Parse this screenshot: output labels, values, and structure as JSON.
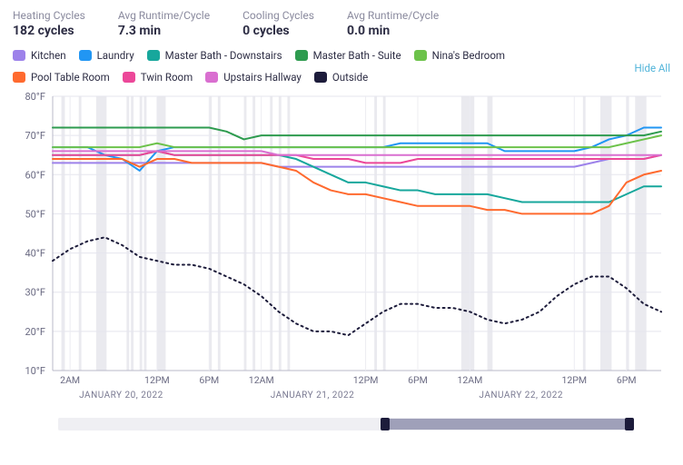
{
  "stats": {
    "heating_cycles_label": "Heating Cycles",
    "heating_cycles_value": "182 cycles",
    "avg_heat_runtime_label": "Avg Runtime/Cycle",
    "avg_heat_runtime_value": "7.3 min",
    "cooling_cycles_label": "Cooling Cycles",
    "cooling_cycles_value": "0 cycles",
    "avg_cool_runtime_label": "Avg Runtime/Cycle",
    "avg_cool_runtime_value": "0.0 min"
  },
  "legend": [
    {
      "name": "Kitchen",
      "color": "#9d82ea"
    },
    {
      "name": "Laundry",
      "color": "#2196f3"
    },
    {
      "name": "Master Bath - Downstairs",
      "color": "#17a79c"
    },
    {
      "name": "Master Bath - Suite",
      "color": "#2e9b4f"
    },
    {
      "name": "Nina's Bedroom",
      "color": "#6cc24a"
    },
    {
      "name": "Pool Table Room",
      "color": "#ff6a2f"
    },
    {
      "name": "Twin Room",
      "color": "#ec4899"
    },
    {
      "name": "Upstairs Hallway",
      "color": "#d96fd0"
    },
    {
      "name": "Outside",
      "color": "#1d1c3b"
    }
  ],
  "hide_all": "Hide All",
  "chart_data": {
    "type": "line",
    "title": "",
    "xlabel": "",
    "ylabel": "°F",
    "ylim": [
      10,
      80
    ],
    "y_ticks": [
      10,
      20,
      30,
      40,
      50,
      60,
      70,
      80
    ],
    "y_tick_suffix": "°F",
    "x_ticks_top": [
      "2AM",
      "12PM",
      "6PM",
      "12AM",
      "12PM",
      "6PM",
      "12AM",
      "12PM",
      "6PM"
    ],
    "x_dates": [
      "JANUARY 20, 2022",
      "JANUARY 21, 2022",
      "JANUARY 22, 2022"
    ],
    "x": [
      0,
      2,
      4,
      6,
      8,
      10,
      12,
      14,
      16,
      18,
      20,
      22,
      24,
      26,
      28,
      30,
      32,
      34,
      36,
      38,
      40,
      42,
      44,
      46,
      48,
      50,
      52,
      54,
      56,
      58,
      60,
      62,
      64,
      66,
      68,
      70
    ],
    "series": [
      {
        "name": "Kitchen",
        "color": "#9d82ea",
        "values": [
          63,
          63,
          63,
          63,
          63,
          63,
          63,
          63,
          63,
          63,
          63,
          63,
          63,
          62,
          62,
          62,
          62,
          62,
          62,
          62,
          62,
          62,
          62,
          62,
          62,
          62,
          62,
          62,
          62,
          62,
          62,
          63,
          64,
          64,
          64,
          65
        ]
      },
      {
        "name": "Laundry",
        "color": "#2196f3",
        "values": [
          67,
          67,
          67,
          65,
          64,
          61,
          66,
          67,
          67,
          67,
          67,
          67,
          67,
          67,
          67,
          67,
          67,
          67,
          67,
          67,
          68,
          68,
          68,
          68,
          68,
          68,
          66,
          66,
          66,
          66,
          66,
          67,
          69,
          70,
          72,
          72
        ]
      },
      {
        "name": "Master Bath - Downstairs",
        "color": "#17a79c",
        "values": [
          65,
          65,
          65,
          65,
          65,
          65,
          66,
          65,
          65,
          65,
          65,
          65,
          65,
          65,
          64,
          62,
          60,
          58,
          58,
          57,
          56,
          56,
          55,
          55,
          55,
          55,
          54,
          53,
          53,
          53,
          53,
          53,
          53,
          55,
          57,
          57
        ]
      },
      {
        "name": "Master Bath - Suite",
        "color": "#2e9b4f",
        "values": [
          72,
          72,
          72,
          72,
          72,
          72,
          72,
          72,
          72,
          72,
          71,
          69,
          70,
          70,
          70,
          70,
          70,
          70,
          70,
          70,
          70,
          70,
          70,
          70,
          70,
          70,
          70,
          70,
          70,
          70,
          70,
          70,
          70,
          70,
          70,
          71
        ]
      },
      {
        "name": "Nina's Bedroom",
        "color": "#6cc24a",
        "values": [
          67,
          67,
          67,
          67,
          67,
          67,
          68,
          67,
          67,
          67,
          67,
          67,
          67,
          67,
          67,
          67,
          67,
          67,
          67,
          67,
          67,
          67,
          67,
          67,
          67,
          67,
          67,
          67,
          67,
          67,
          67,
          67,
          67,
          68,
          69,
          70
        ]
      },
      {
        "name": "Pool Table Room",
        "color": "#ff6a2f",
        "values": [
          64,
          64,
          64,
          64,
          64,
          62,
          64,
          64,
          63,
          63,
          63,
          63,
          63,
          62,
          61,
          58,
          56,
          55,
          55,
          54,
          53,
          52,
          52,
          52,
          52,
          51,
          51,
          50,
          50,
          50,
          50,
          50,
          52,
          58,
          60,
          61
        ]
      },
      {
        "name": "Twin Room",
        "color": "#ec4899",
        "values": [
          65,
          65,
          65,
          65,
          65,
          65,
          66,
          65,
          65,
          65,
          65,
          65,
          65,
          65,
          65,
          64,
          64,
          64,
          63,
          63,
          63,
          64,
          64,
          64,
          64,
          64,
          64,
          64,
          64,
          64,
          64,
          64,
          64,
          64,
          64,
          65
        ]
      },
      {
        "name": "Upstairs Hallway",
        "color": "#d96fd0",
        "values": [
          66,
          66,
          66,
          66,
          66,
          66,
          66,
          66,
          66,
          66,
          66,
          66,
          66,
          65,
          65,
          65,
          65,
          65,
          65,
          65,
          65,
          65,
          65,
          65,
          65,
          65,
          65,
          65,
          65,
          65,
          65,
          65,
          65,
          65,
          65,
          65
        ]
      },
      {
        "name": "Outside",
        "color": "#1d1c3b",
        "dotted": true,
        "values": [
          38,
          41,
          43,
          44,
          42,
          39,
          38,
          37,
          37,
          36,
          34,
          32,
          29,
          25,
          22,
          20,
          20,
          19,
          22,
          25,
          27,
          27,
          26,
          26,
          25,
          23,
          22,
          23,
          25,
          29,
          32,
          34,
          34,
          31,
          27,
          25
        ]
      }
    ],
    "heating_bands_x": [
      1,
      3,
      5,
      8.5,
      9,
      10,
      10.5,
      12,
      18,
      19,
      22,
      23,
      25,
      26,
      27,
      37,
      38,
      47,
      50,
      61,
      63,
      66,
      67
    ],
    "heating_bands_w": [
      0.4,
      0.3,
      1.2,
      0.3,
      0.3,
      0.3,
      0.3,
      1.0,
      0.3,
      0.3,
      0.3,
      0.3,
      0.3,
      0.3,
      0.3,
      0.3,
      0.3,
      1.5,
      0.6,
      0.3,
      1.3,
      0.3,
      1.3
    ]
  },
  "scroll": {
    "thumb_left_pct": 56,
    "thumb_width_pct": 44,
    "cap_left_pct": 56,
    "cap_right_pct": 98.5
  }
}
